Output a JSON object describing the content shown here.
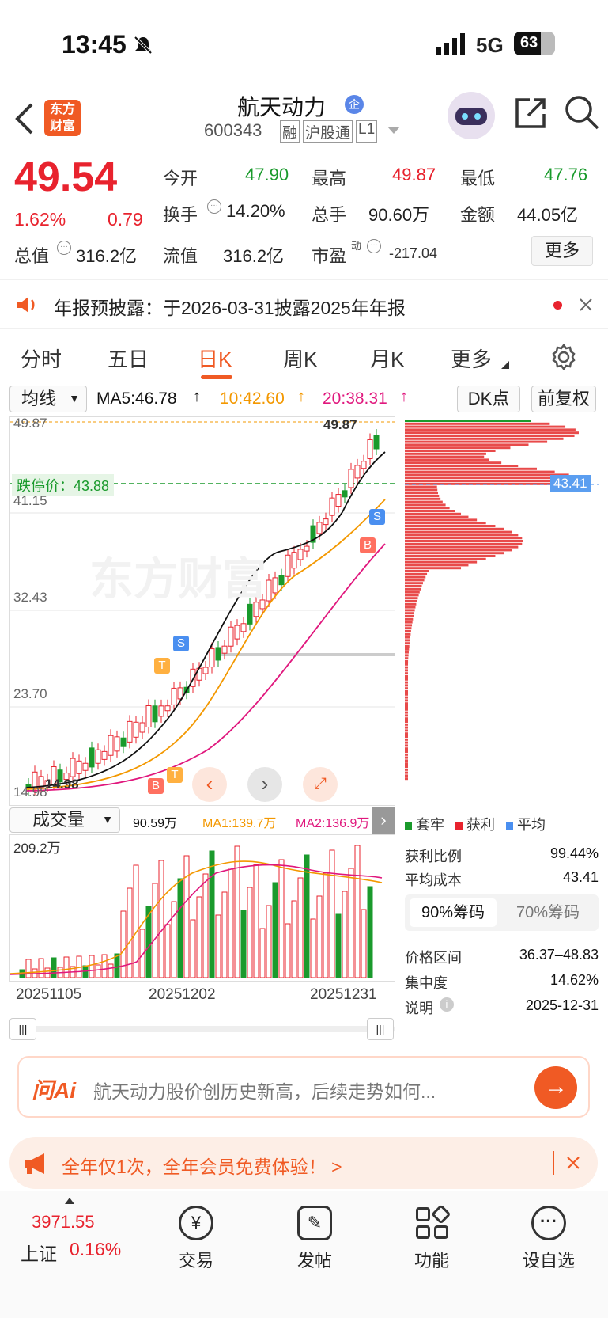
{
  "status_bar": {
    "time": "13:45",
    "network": "5G",
    "battery": "63"
  },
  "header": {
    "logo_line1": "东方",
    "logo_line2": "财富",
    "stock_name": "航天动力",
    "badge": "企",
    "stock_code": "600343",
    "tags": [
      "融",
      "沪股通",
      "L1"
    ]
  },
  "quote": {
    "price": "49.54",
    "change_pct": "1.62%",
    "change": "0.79",
    "open_label": "今开",
    "open": "47.90",
    "high_label": "最高",
    "high": "49.87",
    "low_label": "最低",
    "low": "47.76",
    "turnover_label": "换手",
    "turnover": "14.20%",
    "volume_label": "总手",
    "volume": "90.60万",
    "amount_label": "金额",
    "amount": "44.05亿",
    "mcap_label": "总值",
    "mcap": "316.2亿",
    "float_label": "流值",
    "float_mcap": "316.2亿",
    "pe_label": "市盈",
    "pe_sup": "动",
    "pe": "-217.04",
    "more_button": "更多"
  },
  "notice": {
    "text": "年报预披露：于2026-03-31披露2025年年报"
  },
  "tabs": [
    "分时",
    "五日",
    "日K",
    "周K",
    "月K",
    "更多"
  ],
  "active_tab": "日K",
  "chart_toolbar": {
    "ma_select": "均线",
    "ma5": "MA5:46.78",
    "ma10": "10:42.60",
    "ma20": "20:38.31",
    "dk_button": "DK点",
    "adjust_button": "前复权"
  },
  "kline": {
    "y_labels": [
      "49.87",
      "41.15",
      "32.43",
      "23.70",
      "14.98"
    ],
    "high_marker": "49.87",
    "low_marker": "14.98",
    "limit_down_label": "跌停价：43.88",
    "watermark": "东方财富",
    "signals": [
      "T",
      "S",
      "T",
      "B",
      "S",
      "B"
    ]
  },
  "chip": {
    "avg_cost_marker": "43.41",
    "legend": [
      "套牢",
      "获利",
      "平均"
    ],
    "profit_ratio_label": "获利比例",
    "profit_ratio": "99.44%",
    "avg_cost_label": "平均成本",
    "avg_cost": "43.41",
    "tab_90": "90%筹码",
    "tab_70": "70%筹码",
    "range_label": "价格区间",
    "range": "36.37–48.83",
    "concentration_label": "集中度",
    "concentration": "14.62%",
    "note_label": "说明",
    "note_date": "2025-12-31"
  },
  "volume": {
    "select": "成交量",
    "current": "90.59万",
    "ma1": "MA1:139.7万",
    "ma2": "MA2:136.9万",
    "max_label": "209.2万",
    "dates": [
      "20251105",
      "20251202",
      "20251231"
    ]
  },
  "ai": {
    "logo": "问Ai",
    "placeholder": "航天动力股价创历史新高，后续走势如何..."
  },
  "promo": {
    "text": "全年仅1次，全年会员免费体验！ >"
  },
  "bottom_nav": {
    "index_value": "3971.55",
    "index_name": "上证",
    "index_change": "0.16%",
    "items": [
      "交易",
      "发帖",
      "功能",
      "设自选"
    ]
  },
  "colors": {
    "up": "#e8232e",
    "down": "#1a9a2c",
    "accent": "#ff5a1f",
    "ma5": "#111111",
    "ma10": "#f39800",
    "ma20": "#e0177d"
  }
}
